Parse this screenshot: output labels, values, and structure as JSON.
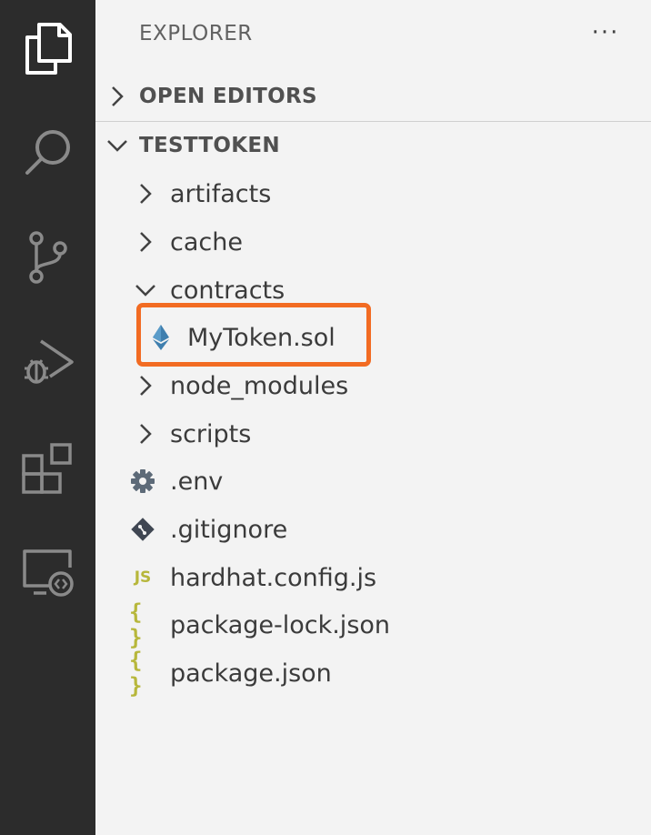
{
  "activity_bar": {
    "icons": [
      "files-icon",
      "search-icon",
      "source-control-icon",
      "run-debug-icon",
      "extensions-icon",
      "remote-explorer-icon"
    ]
  },
  "sidebar": {
    "title": "EXPLORER",
    "more_label": "···",
    "open_editors": {
      "label": "OPEN EDITORS",
      "expanded": false
    },
    "project": {
      "label": "TESTTOKEN",
      "expanded": true
    }
  },
  "tree": {
    "artifacts": "artifacts",
    "cache": "cache",
    "contracts": "contracts",
    "mytoken": "MyToken.sol",
    "node_modules": "node_modules",
    "scripts": "scripts",
    "env": ".env",
    "gitignore": ".gitignore",
    "hardhat": "hardhat.config.js",
    "package_lock": "package-lock.json",
    "package": "package.json"
  },
  "icon_glyphs": {
    "js": "JS",
    "json": "{ }"
  },
  "colors": {
    "highlight": "#f26b22",
    "ethereum": "#3f7fae",
    "js_json": "#b7b73b",
    "config": "#5d6a78"
  }
}
